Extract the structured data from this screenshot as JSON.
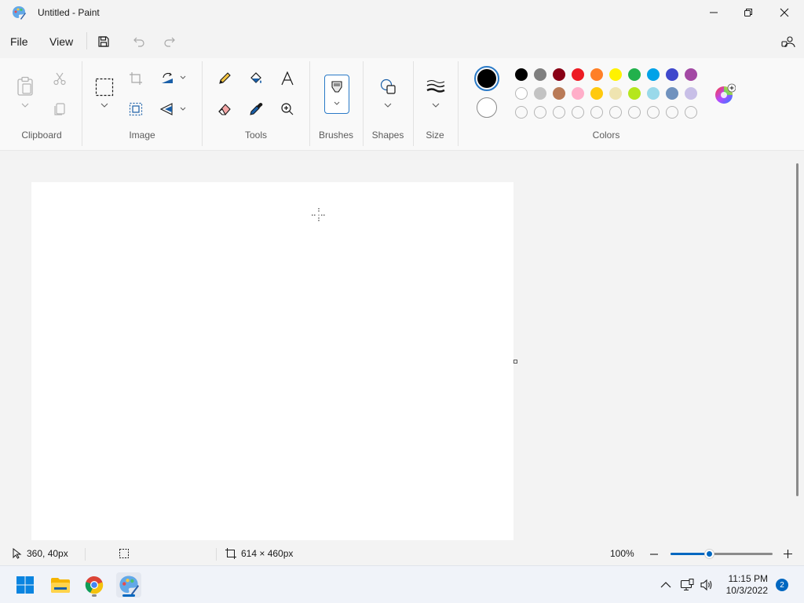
{
  "window": {
    "title": "Untitled - Paint"
  },
  "menu": {
    "file": "File",
    "view": "View"
  },
  "ribbon": {
    "groups": {
      "clipboard": "Clipboard",
      "image": "Image",
      "tools": "Tools",
      "brushes": "Brushes",
      "shapes": "Shapes",
      "size": "Size",
      "colors": "Colors"
    },
    "primary_color": "#000000",
    "secondary_color": "#ffffff",
    "palette_row1": [
      "#000000",
      "#7f7f7f",
      "#880015",
      "#ed1c24",
      "#ff7f27",
      "#fff200",
      "#22b14c",
      "#00a2e8",
      "#3f48cc",
      "#a349a4"
    ],
    "palette_row2": [
      "#ffffff",
      "#c3c3c3",
      "#b97a57",
      "#ffaec9",
      "#ffc90e",
      "#efe4b0",
      "#b5e61d",
      "#99d9ea",
      "#7092be",
      "#c8bfe7"
    ],
    "palette_row3_empty_count": 10
  },
  "status": {
    "cursor_position": "360, 40px",
    "canvas_size": "614 × 460px",
    "zoom": "100%",
    "zoom_level": 0.38
  },
  "taskbar": {
    "time": "11:15 PM",
    "date": "10/3/2022",
    "notification_count": "2"
  },
  "accent": "#0067c0"
}
